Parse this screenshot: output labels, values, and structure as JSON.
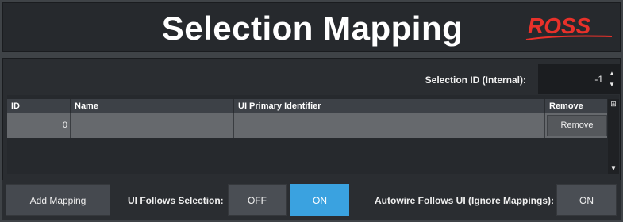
{
  "header": {
    "title": "Selection Mapping",
    "logo_text": "ROSS"
  },
  "selection_id": {
    "label": "Selection ID (Internal):",
    "value": "-1"
  },
  "table": {
    "columns": [
      "ID",
      "Name",
      "UI Primary Identifier",
      "Remove"
    ],
    "rows": [
      {
        "id": "0",
        "name": "",
        "uid": "",
        "remove_label": "Remove"
      }
    ]
  },
  "bottom": {
    "add_label": "Add Mapping",
    "ui_follows_label": "UI Follows Selection:",
    "off_label": "OFF",
    "on_label": "ON",
    "autowire_label": "Autowire Follows UI (Ignore Mappings):",
    "autowire_on_label": "ON"
  },
  "colors": {
    "accent": "#3aa2e0",
    "logo": "#e8312a"
  }
}
